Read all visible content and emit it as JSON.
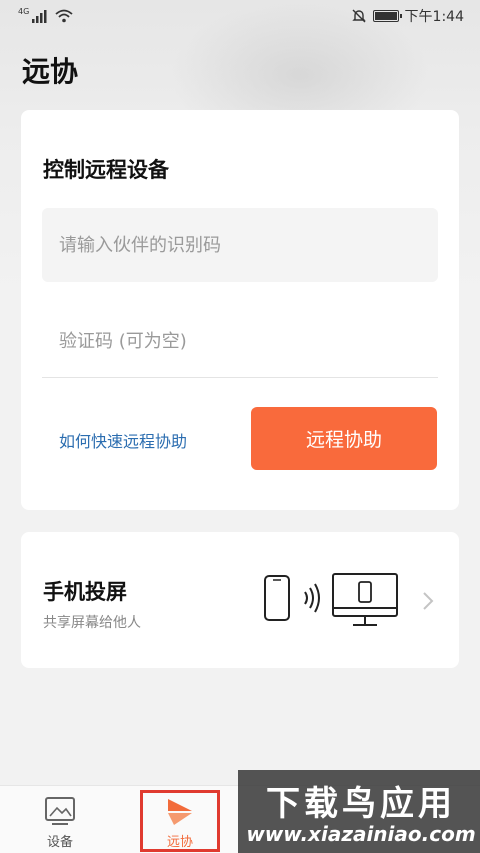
{
  "status_bar": {
    "network": "4G",
    "time": "下午1:44"
  },
  "page": {
    "title": "远协"
  },
  "remote_card": {
    "title": "控制远程设备",
    "partner_id_placeholder": "请输入伙伴的识别码",
    "partner_id_value": "",
    "verify_code_placeholder": "验证码 (可为空)",
    "verify_code_value": "",
    "help_link": "如何快速远程协助",
    "assist_button": "远程协助"
  },
  "mirror_card": {
    "title": "手机投屏",
    "subtitle": "共享屏幕给他人"
  },
  "bottom_nav": {
    "items": [
      {
        "label": "设备",
        "icon": "devices-icon"
      },
      {
        "label": "远协",
        "icon": "remote-assist-icon",
        "active": true
      }
    ]
  },
  "watermark": {
    "main": "下载鸟应用",
    "sub": "www.xiazainiao.com"
  },
  "colors": {
    "accent": "#f96a3c",
    "link": "#2b6db0",
    "active_nav_outline": "#e03a2f"
  }
}
